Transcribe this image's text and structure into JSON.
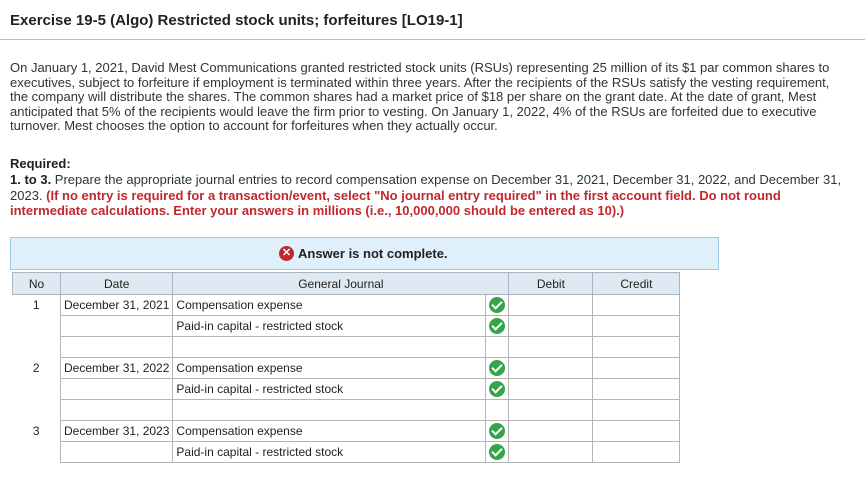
{
  "title": "Exercise 19-5 (Algo) Restricted stock units; forfeitures [LO19-1]",
  "paragraph": "On January 1, 2021, David Mest Communications granted restricted stock units (RSUs) representing 25 million of its $1 par common shares to executives, subject to forfeiture if employment is terminated within three years. After the recipients of the RSUs satisfy the vesting requirement, the company will distribute the shares. The common shares had a market price of $18 per share on the grant date. At the date of grant, Mest anticipated that 5% of the recipients would leave the firm prior to vesting. On January 1, 2022, 4% of the RSUs are forfeited due to executive turnover. Mest chooses the option to account for forfeitures when they actually occur.",
  "required": {
    "heading": "Required:",
    "number": "1. to 3.",
    "text": " Prepare the appropriate journal entries to record compensation expense on December 31, 2021, December 31, 2022, and December 31, 2023. ",
    "instruction": "(If no entry is required for a transaction/event, select \"No journal entry required\" in the first account field. Do not round intermediate calculations. Enter your answers in millions (i.e., 10,000,000 should be entered as 10).)"
  },
  "status": {
    "text": "Answer is not complete.",
    "icon": "x-circle-icon",
    "color": "#c0282d"
  },
  "table": {
    "headers": {
      "no": "No",
      "date": "Date",
      "journal": "General Journal",
      "debit": "Debit",
      "credit": "Credit"
    },
    "entries": [
      {
        "no": "1",
        "date": "December 31, 2021",
        "debit_account": "Compensation expense",
        "credit_account": "Paid-in capital - restricted stock"
      },
      {
        "no": "2",
        "date": "December 31, 2022",
        "debit_account": "Compensation expense",
        "credit_account": "Paid-in capital - restricted stock"
      },
      {
        "no": "3",
        "date": "December 31, 2023",
        "debit_account": "Compensation expense",
        "credit_account": "Paid-in capital - restricted stock"
      }
    ]
  },
  "colors": {
    "check": "#35a44a",
    "instruction_red": "#c0282d",
    "status_bg": "#dff0fb"
  }
}
